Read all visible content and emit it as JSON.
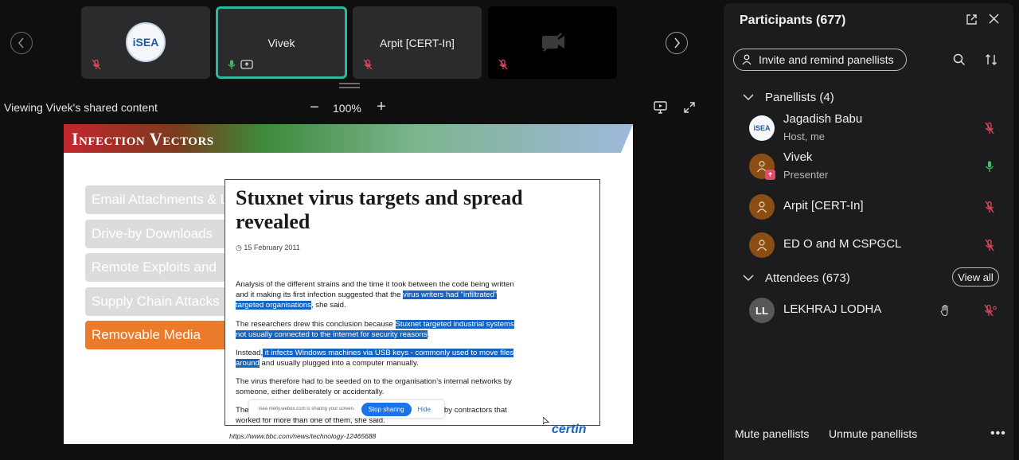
{
  "stage": {
    "tiles": [
      {
        "name": "",
        "logo_text": "iSEA",
        "mic": "muted"
      },
      {
        "name": "Vivek",
        "mic": "active",
        "sharing": true
      },
      {
        "name": "Arpit [CERT-In]",
        "mic": "muted"
      },
      {
        "name": "",
        "video": "off",
        "mic": "muted"
      }
    ],
    "viewing_label": "Viewing Vivek's shared content",
    "zoom": {
      "minus": "−",
      "level": "100%",
      "plus": "+"
    }
  },
  "slide": {
    "title": "Infection Vectors",
    "vectors": [
      {
        "label": "Email Attachments & Links",
        "selected": false
      },
      {
        "label": "Drive-by Downloads",
        "selected": false
      },
      {
        "label": "Remote Exploits and",
        "selected": false
      },
      {
        "label": "Supply Chain Attacks",
        "selected": false
      },
      {
        "label": "Removable Media",
        "selected": true
      }
    ],
    "article": {
      "title": "Stuxnet virus targets and spread revealed",
      "date": "15 February 2011",
      "p1_a": "Analysis of the different strains and the time it took between the code being written and it making its first infection suggested that the ",
      "p1_hl": "virus writers had \"infiltrated\" targeted organisations",
      "p1_b": ", she said.",
      "p2_a": "The researchers drew this conclusion because ",
      "p2_hl": "Stuxnet targeted industrial systems not usually connected to the internet for security reasons",
      "p2_b": ".",
      "p3_a": "Instead,",
      "p3_hl": " it infects Windows machines via USB keys - commonly used to move files around",
      "p3_b": " and usually plugged into a computer manually.",
      "p4": "The virus therefore had to be seeded on to the organisation's internal networks by someone, either deliberately or accidentally.",
      "p5_a": "The v",
      "p5_b": "tions by contractors that worked for more than one of them, she said.",
      "share_notice": "isea meity.webex.com is sharing your screen.",
      "stop_label": "Stop sharing",
      "hide_label": "Hide"
    },
    "source_url": "https://www.bbc.com/news/technology-12465688",
    "logo_text": "certin"
  },
  "panel": {
    "title": "Participants (677)",
    "invite_label": "Invite and remind panellists",
    "panellists_header": "Panellists (4)",
    "attendees_header": "Attendees (673)",
    "view_all_label": "View all",
    "panellists": [
      {
        "name": "Jagadish Babu",
        "role": "Host, me",
        "mic": "muted",
        "avatar": "logo",
        "avatar_text": "iSEA"
      },
      {
        "name": "Vivek",
        "role": "Presenter",
        "mic": "active",
        "avatar": "person"
      },
      {
        "name": "Arpit [CERT-In]",
        "role": "",
        "mic": "muted",
        "avatar": "person"
      },
      {
        "name": "ED O and M CSPGCL",
        "role": "",
        "mic": "muted",
        "avatar": "person"
      }
    ],
    "attendees": [
      {
        "name": "LEKHRAJ LODHA",
        "initials": "LL",
        "mic": "muted"
      }
    ],
    "mute_label": "Mute panellists",
    "unmute_label": "Unmute panellists"
  },
  "colors": {
    "accent": "#29b8a0",
    "muted_red": "#e0485e",
    "active_green": "#3fbf6a",
    "highlight": "#1565c0",
    "selected_vector": "#ec7a2b"
  }
}
